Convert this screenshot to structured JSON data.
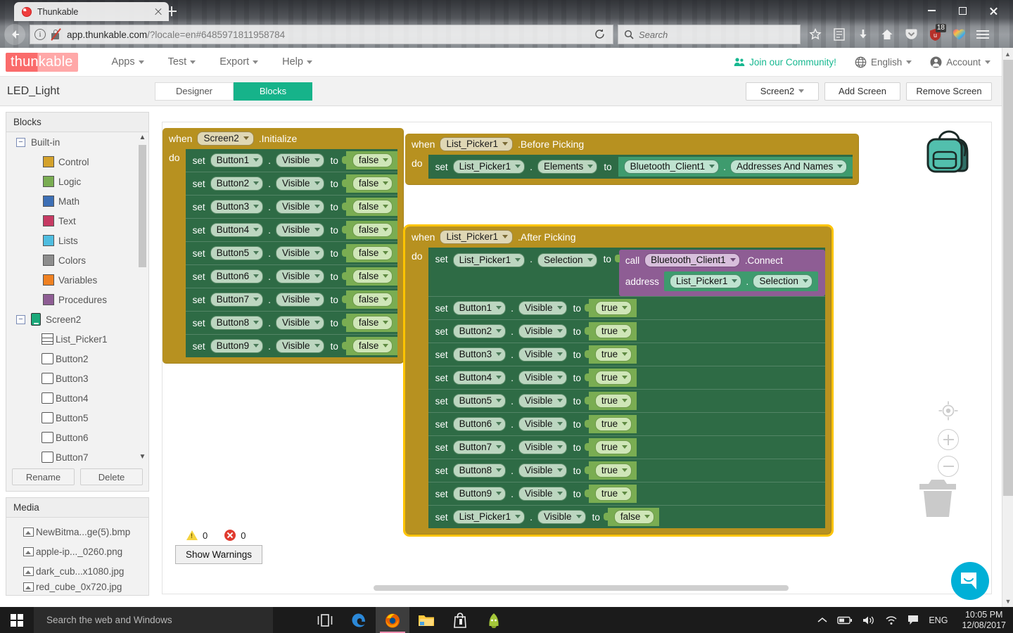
{
  "browser": {
    "tab_title": "Thunkable",
    "tab_favicon": "thunkable-favicon-icon",
    "new_tab": "new-tab-icon",
    "url": "app.thunkable.com",
    "url_rest": "/?locale=en#6485971811958784",
    "search_placeholder": "Search",
    "reader_badge": "18",
    "window_minimize": "minimize-icon",
    "window_restore": "restore-icon",
    "window_close": "close-icon"
  },
  "header": {
    "logo": "thunkable",
    "menus": [
      {
        "label": "Apps"
      },
      {
        "label": "Test"
      },
      {
        "label": "Export"
      },
      {
        "label": "Help"
      }
    ],
    "community": "Join our Community!",
    "language": "English",
    "account": "Account"
  },
  "project_bar": {
    "project_name": "LED_Light",
    "tabs": [
      {
        "label": "Designer",
        "active": false
      },
      {
        "label": "Blocks",
        "active": true
      }
    ],
    "screen_selector": "Screen2",
    "add_screen": "Add Screen",
    "remove_screen": "Remove Screen"
  },
  "sidebar": {
    "blocks_panel_title": "Blocks",
    "builtin_label": "Built-in",
    "builtin_items": [
      {
        "label": "Control",
        "color": "#d4a22c"
      },
      {
        "label": "Logic",
        "color": "#7aad52"
      },
      {
        "label": "Math",
        "color": "#3d6fb5"
      },
      {
        "label": "Text",
        "color": "#c63a63"
      },
      {
        "label": "Lists",
        "color": "#4fbde0"
      },
      {
        "label": "Colors",
        "color": "#8d8d8d"
      },
      {
        "label": "Variables",
        "color": "#ef8122"
      },
      {
        "label": "Procedures",
        "color": "#8e5d94"
      }
    ],
    "screen_label": "Screen2",
    "components": [
      {
        "label": "List_Picker1",
        "icon": "list-picker-icon"
      },
      {
        "label": "Button2",
        "icon": "button-icon"
      },
      {
        "label": "Button3",
        "icon": "button-icon"
      },
      {
        "label": "Button4",
        "icon": "button-icon"
      },
      {
        "label": "Button5",
        "icon": "button-icon"
      },
      {
        "label": "Button6",
        "icon": "button-icon"
      },
      {
        "label": "Button7",
        "icon": "button-icon"
      }
    ],
    "rename": "Rename",
    "delete": "Delete",
    "media_panel_title": "Media",
    "media": [
      {
        "label": "NewBitma...ge(5).bmp"
      },
      {
        "label": "apple-ip..._0260.png"
      },
      {
        "label": "dark_cub...x1080.jpg"
      },
      {
        "label": "red_cube_0x720.jpg"
      }
    ]
  },
  "canvas": {
    "blocks": [
      {
        "id": "screen2-initialize",
        "when": "when",
        "component": "Screen2",
        "event": ".Initialize",
        "do": "do",
        "selected": false,
        "rows": [
          {
            "set": "set",
            "component": "Button1",
            "property": "Visible",
            "to": "to",
            "value": "false"
          },
          {
            "set": "set",
            "component": "Button2",
            "property": "Visible",
            "to": "to",
            "value": "false"
          },
          {
            "set": "set",
            "component": "Button3",
            "property": "Visible",
            "to": "to",
            "value": "false"
          },
          {
            "set": "set",
            "component": "Button4",
            "property": "Visible",
            "to": "to",
            "value": "false"
          },
          {
            "set": "set",
            "component": "Button5",
            "property": "Visible",
            "to": "to",
            "value": "false"
          },
          {
            "set": "set",
            "component": "Button6",
            "property": "Visible",
            "to": "to",
            "value": "false"
          },
          {
            "set": "set",
            "component": "Button7",
            "property": "Visible",
            "to": "to",
            "value": "false"
          },
          {
            "set": "set",
            "component": "Button8",
            "property": "Visible",
            "to": "to",
            "value": "false"
          },
          {
            "set": "set",
            "component": "Button9",
            "property": "Visible",
            "to": "to",
            "value": "false"
          }
        ]
      },
      {
        "id": "listpicker-before-picking",
        "when": "when",
        "component": "List_Picker1",
        "event": ".Before Picking",
        "do": "do",
        "selected": false,
        "row": {
          "set": "set",
          "component": "List_Picker1",
          "property": "Elements",
          "to": "to",
          "get_component": "Bluetooth_Client1",
          "get_property": "Addresses And Names"
        }
      },
      {
        "id": "listpicker-after-picking",
        "when": "when",
        "component": "List_Picker1",
        "event": ".After Picking",
        "do": "do",
        "selected": true,
        "first_row": {
          "set": "set",
          "component": "List_Picker1",
          "property": "Selection",
          "to": "to"
        },
        "call": {
          "call": "call",
          "component": "Bluetooth_Client1",
          "method": ".Connect",
          "arg_label": "address",
          "arg_component": "List_Picker1",
          "arg_property": "Selection"
        },
        "rows": [
          {
            "set": "set",
            "component": "Button1",
            "property": "Visible",
            "to": "to",
            "value": "true"
          },
          {
            "set": "set",
            "component": "Button2",
            "property": "Visible",
            "to": "to",
            "value": "true"
          },
          {
            "set": "set",
            "component": "Button3",
            "property": "Visible",
            "to": "to",
            "value": "true"
          },
          {
            "set": "set",
            "component": "Button4",
            "property": "Visible",
            "to": "to",
            "value": "true"
          },
          {
            "set": "set",
            "component": "Button5",
            "property": "Visible",
            "to": "to",
            "value": "true"
          },
          {
            "set": "set",
            "component": "Button6",
            "property": "Visible",
            "to": "to",
            "value": "true"
          },
          {
            "set": "set",
            "component": "Button7",
            "property": "Visible",
            "to": "to",
            "value": "true"
          },
          {
            "set": "set",
            "component": "Button8",
            "property": "Visible",
            "to": "to",
            "value": "true"
          },
          {
            "set": "set",
            "component": "Button9",
            "property": "Visible",
            "to": "to",
            "value": "true"
          },
          {
            "set": "set",
            "component": "List_Picker1",
            "property": "Visible",
            "to": "to",
            "value": "false"
          }
        ]
      }
    ],
    "warnings_count": "0",
    "errors_count": "0",
    "show_warnings": "Show Warnings",
    "backpack": "backpack-icon",
    "center_blocks": "center-blocks-icon",
    "zoom_in": "zoom-in-icon",
    "zoom_out": "zoom-out-icon",
    "trash": "trash-icon",
    "intercom": "intercom-chat-icon"
  },
  "taskbar": {
    "search_placeholder": "Search the web and Windows",
    "apps": [
      {
        "name": "task-view-icon"
      },
      {
        "name": "edge-icon"
      },
      {
        "name": "firefox-icon"
      },
      {
        "name": "file-explorer-icon"
      },
      {
        "name": "store-icon"
      },
      {
        "name": "android-studio-icon"
      }
    ],
    "language": "ENG",
    "time": "10:05 PM",
    "date": "12/08/2017"
  },
  "colors": {
    "accent_green": "#16b38a",
    "brand_red": "#fa6b6b",
    "event_gold": "#b79120",
    "selected_outline": "#ffc400",
    "set_green": "#2e6b45",
    "logic_green": "#7aad52",
    "get_green": "#3e9b6e",
    "call_purple": "#8e5d94",
    "intercom_blue": "#00b0d7"
  }
}
